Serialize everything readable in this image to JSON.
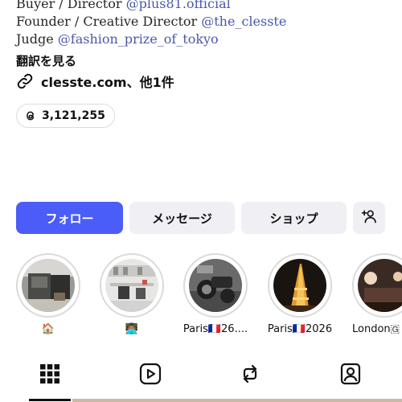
{
  "bio": {
    "line1": {
      "prefix": "Buyer / Director ",
      "mention": "@plus81.official"
    },
    "line2": {
      "prefix": "Founder / Creative Director ",
      "mention": "@the_clesste"
    },
    "line3": {
      "prefix": "Judge ",
      "mention": "@fashion_prize_of_tokyo"
    }
  },
  "translate_label": "翻訳を見る",
  "links": {
    "icon": "link-icon",
    "text": "clesste.com、他1件"
  },
  "threads": {
    "icon": "threads-icon",
    "count": "3,121,255"
  },
  "buttons": {
    "follow": "フォロー",
    "message": "メッセージ",
    "shop": "ショップ",
    "add_person_icon": "add-person-icon"
  },
  "colors": {
    "follow_bg": "#4a5df9",
    "button_bg": "#efeff4",
    "mention": "#4a58a8"
  },
  "highlights": [
    {
      "label": "🏠",
      "image": "interior-room"
    },
    {
      "label": "👨🏽‍💻",
      "image": "office-desk"
    },
    {
      "label": "Paris🇫🇷26....",
      "image": "motorcycle-bw"
    },
    {
      "label": "Paris🇫🇷2026",
      "image": "eiffel-tower-night"
    },
    {
      "label": "London🇬",
      "image": "dim-interior"
    }
  ],
  "tabs": [
    {
      "name": "grid-icon",
      "active": true
    },
    {
      "name": "reels-icon",
      "active": false
    },
    {
      "name": "reposts-icon",
      "active": false
    },
    {
      "name": "tagged-icon",
      "active": false
    }
  ]
}
